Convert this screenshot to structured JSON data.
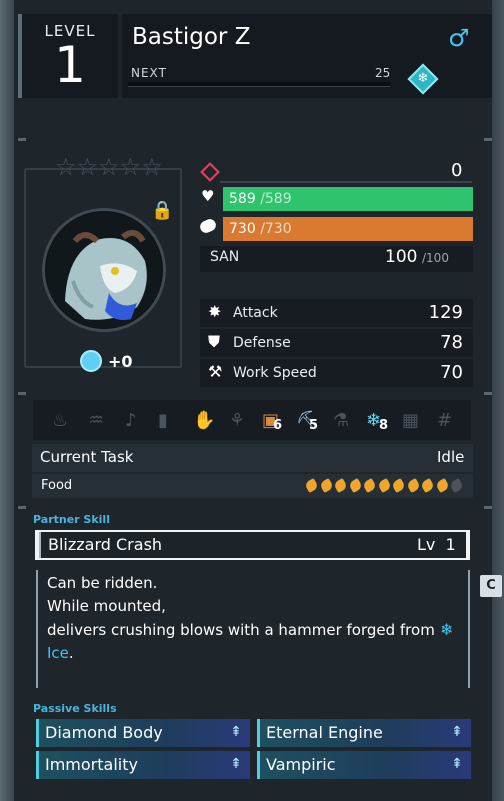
{
  "header": {
    "level_label": "LEVEL",
    "level_value": "1",
    "pal_name": "Bastigor Z",
    "next_label": "NEXT",
    "next_value": "25",
    "gender_icon": "male-icon",
    "element_icon": "ice-element-icon"
  },
  "portrait": {
    "rank_stars": 0,
    "soul_value": "+0",
    "locked": true
  },
  "stats": {
    "condensed_value": "0",
    "hp_current": "589",
    "hp_max": "/589",
    "stamina_current": "730",
    "stamina_max": "/730",
    "san_label": "SAN",
    "san_value": "100",
    "san_max": "/100",
    "attack_label": "Attack",
    "attack_value": "129",
    "defense_label": "Defense",
    "defense_value": "78",
    "workspeed_label": "Work Speed",
    "workspeed_value": "70"
  },
  "work_suitability": {
    "lumbering_level": "6",
    "mining_level": "5",
    "cooling_level": "8"
  },
  "status": {
    "task_label": "Current Task",
    "task_value": "Idle",
    "food_label": "Food",
    "food_filled": 10,
    "food_total": 11
  },
  "partner_skill": {
    "section_label": "Partner Skill",
    "name": "Blizzard Crash",
    "level": "Lv  1",
    "desc_line1": "Can be ridden.",
    "desc_line2": "While mounted,",
    "desc_line3": "delivers crushing blows with a hammer forged from",
    "desc_line4": "Ice",
    "desc_line4_suffix": "."
  },
  "side_button": "C",
  "passive_skills": {
    "section_label": "Passive Skills",
    "items": [
      "Diamond Body",
      "Eternal Engine",
      "Immortality",
      "Vampiric"
    ]
  },
  "colors": {
    "hp": "#2ec46e",
    "stamina": "#d97a30",
    "accent": "#49b4e0",
    "lock": "#f0c21a"
  }
}
